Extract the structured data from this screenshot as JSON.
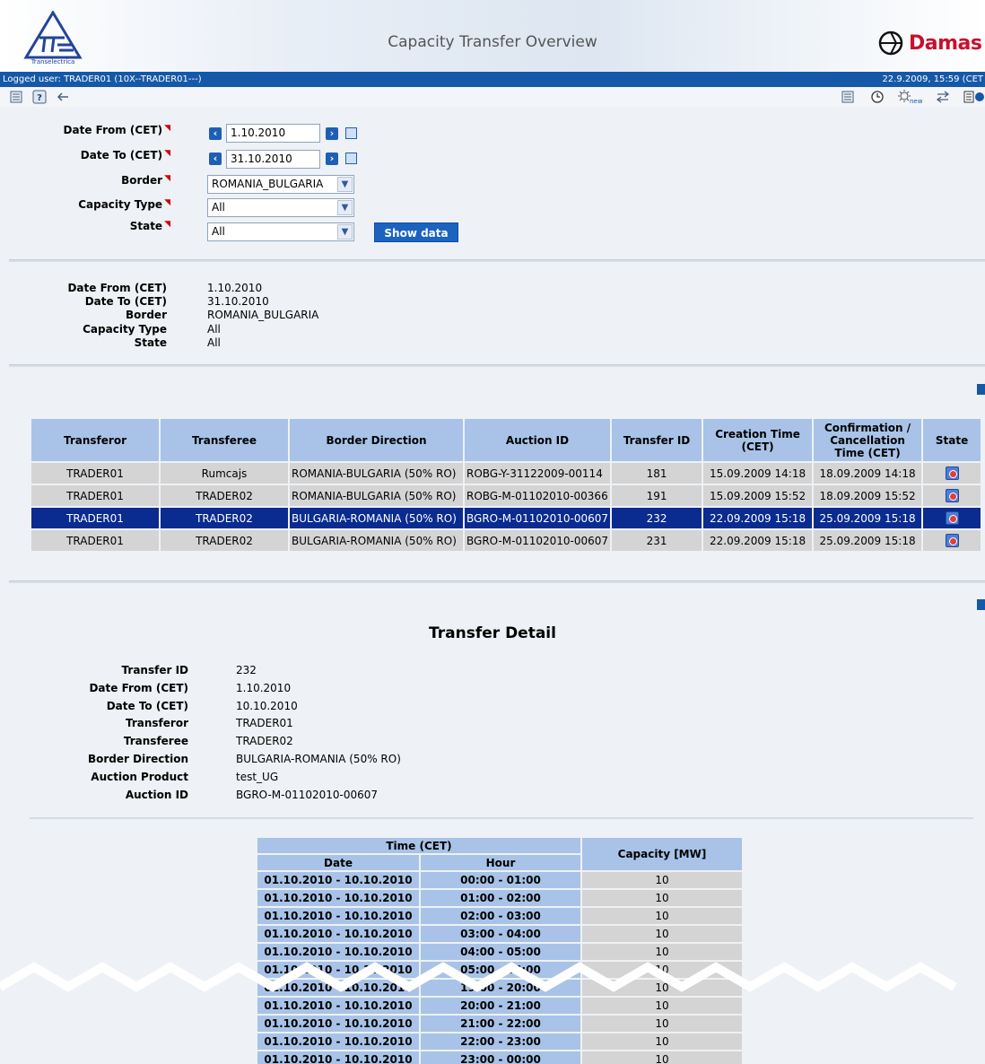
{
  "header": {
    "logo_text": "Transelectrica",
    "title": "Capacity Transfer Overview",
    "brand": "Damas"
  },
  "userbar": {
    "logged_user": "Logged user: TRADER01 (10X--TRADER01---)",
    "datetime": "22.9.2009, 15:59  (CET"
  },
  "toolbar": {
    "left_icons": [
      "list-icon",
      "help-icon",
      "back-arrow-icon"
    ],
    "right_icons": [
      "list-icon",
      "clock-icon",
      "new-icon",
      "swap-icon",
      "export-icon"
    ]
  },
  "filters": {
    "date_from_label": "Date From (CET)",
    "date_from_value": "1.10.2010",
    "date_to_label": "Date To (CET)",
    "date_to_value": "31.10.2010",
    "border_label": "Border",
    "border_value": "ROMANIA_BULGARIA",
    "capacity_type_label": "Capacity Type",
    "capacity_type_value": "All",
    "state_label": "State",
    "state_value": "All",
    "show_button": "Show data"
  },
  "summary": {
    "labels": [
      "Date From (CET)",
      "Date To (CET)",
      "Border",
      "Capacity Type",
      "State"
    ],
    "values": [
      "1.10.2010",
      "31.10.2010",
      "ROMANIA_BULGARIA",
      "All",
      "All"
    ]
  },
  "transfers": {
    "columns": [
      "Transferor",
      "Transferee",
      "Border Direction",
      "Auction ID",
      "Transfer ID",
      "Creation Time (CET)",
      "Confirmation / Cancellation Time (CET)",
      "State"
    ],
    "rows": [
      {
        "transferor": "TRADER01",
        "transferee": "Rumcajs",
        "direction": "ROMANIA-BULGARIA (50% RO)",
        "auction": "ROBG-Y-31122009-00114",
        "id": "181",
        "created": "15.09.2009 14:18",
        "confirmed": "18.09.2009 14:18",
        "selected": false
      },
      {
        "transferor": "TRADER01",
        "transferee": "TRADER02",
        "direction": "ROMANIA-BULGARIA (50% RO)",
        "auction": "ROBG-M-01102010-00366",
        "id": "191",
        "created": "15.09.2009 15:52",
        "confirmed": "18.09.2009 15:52",
        "selected": false
      },
      {
        "transferor": "TRADER01",
        "transferee": "TRADER02",
        "direction": "BULGARIA-ROMANIA (50% RO)",
        "auction": "BGRO-M-01102010-00607",
        "id": "232",
        "created": "22.09.2009 15:18",
        "confirmed": "25.09.2009 15:18",
        "selected": true
      },
      {
        "transferor": "TRADER01",
        "transferee": "TRADER02",
        "direction": "BULGARIA-ROMANIA (50% RO)",
        "auction": "BGRO-M-01102010-00607",
        "id": "231",
        "created": "22.09.2009 15:18",
        "confirmed": "25.09.2009 15:18",
        "selected": false
      }
    ]
  },
  "detail": {
    "title": "Transfer Detail",
    "fields": [
      {
        "label": "Transfer ID",
        "value": "232"
      },
      {
        "label": "Date From (CET)",
        "value": "1.10.2010"
      },
      {
        "label": "Date To (CET)",
        "value": "10.10.2010"
      },
      {
        "label": "Transferor",
        "value": "TRADER01"
      },
      {
        "label": "Transferee",
        "value": "TRADER02"
      },
      {
        "label": "Border Direction",
        "value": "BULGARIA-ROMANIA (50% RO)"
      },
      {
        "label": "Auction Product",
        "value": "test_UG"
      },
      {
        "label": "Auction ID",
        "value": "BGRO-M-01102010-00607"
      }
    ]
  },
  "capacity": {
    "group_header": "Time (CET)",
    "date_header": "Date",
    "hour_header": "Hour",
    "capacity_header": "Capacity [MW]",
    "rows": [
      {
        "date": "01.10.2010 - 10.10.2010",
        "hour": "00:00 - 01:00",
        "cap": "10"
      },
      {
        "date": "01.10.2010 - 10.10.2010",
        "hour": "01:00 - 02:00",
        "cap": "10"
      },
      {
        "date": "01.10.2010 - 10.10.2010",
        "hour": "02:00 - 03:00",
        "cap": "10"
      },
      {
        "date": "01.10.2010 - 10.10.2010",
        "hour": "03:00 - 04:00",
        "cap": "10"
      },
      {
        "date": "01.10.2010 - 10.10.2010",
        "hour": "04:00 - 05:00",
        "cap": "10"
      },
      {
        "date": "01.10.2010 - 10.10.2010",
        "hour": "05:00 - 06:00",
        "cap": "10"
      },
      {
        "date": "01.10.2010 - 10.10.2010",
        "hour": "19:00 - 20:00",
        "cap": "10"
      },
      {
        "date": "01.10.2010 - 10.10.2010",
        "hour": "20:00 - 21:00",
        "cap": "10"
      },
      {
        "date": "01.10.2010 - 10.10.2010",
        "hour": "21:00 - 22:00",
        "cap": "10"
      },
      {
        "date": "01.10.2010 - 10.10.2010",
        "hour": "22:00 - 23:00",
        "cap": "10"
      },
      {
        "date": "01.10.2010 - 10.10.2010",
        "hour": "23:00 - 00:00",
        "cap": "10"
      }
    ]
  }
}
